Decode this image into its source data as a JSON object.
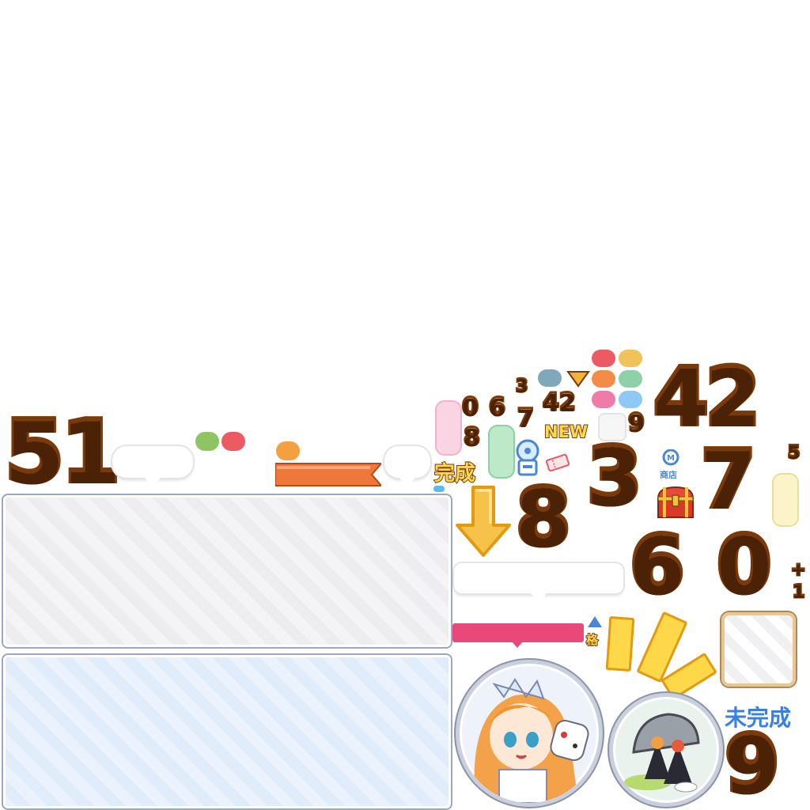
{
  "numbers": {
    "n51": "51",
    "n42_big": "42",
    "n3_big": "3",
    "n7_big": "7",
    "n8_big": "8",
    "n6_big": "6",
    "n0_big": "0",
    "n9_big": "9",
    "small_0": "0",
    "small_6": "6",
    "small_3": "3",
    "small_7": "7",
    "small_42": "42",
    "small_8": "8",
    "small_9": "9",
    "small_5": "5",
    "plus": "+",
    "one": "1"
  },
  "labels": {
    "new": "NEW",
    "complete": "完成",
    "incomplete": "未完成",
    "shop": "商店",
    "rank_char": "格"
  },
  "colors": {
    "orange_digit": "#f39a12",
    "digit_outline": "#7a3a0c",
    "ribbon_orange": "#f0773a",
    "pink_bar": "#e8497a",
    "pill_red": "#ec5a64",
    "pill_green": "#8ec464",
    "pill_orange": "#f4a040",
    "pill_sand": "#f2c25a",
    "pill_teal": "#7fa8b8",
    "pill_pink": "#f07aa8",
    "pill_mint": "#8ed0a8",
    "pill_sky": "#8ec8f4",
    "pill_peach": "#f48c48",
    "arrow_yellow": "#f6c24a",
    "panel_gray": "#eeeeef",
    "panel_blue": "#e5effb"
  },
  "icons": [
    "gacha-capsule-icon",
    "ticket-icon",
    "shop-icon",
    "treasure-chest-icon",
    "down-arrow-icon",
    "up-triangle-icon",
    "down-triangle-icon",
    "sparkle-ray-icon"
  ],
  "portraits": [
    "princess-character-portrait",
    "rice-ball-food-portrait"
  ]
}
